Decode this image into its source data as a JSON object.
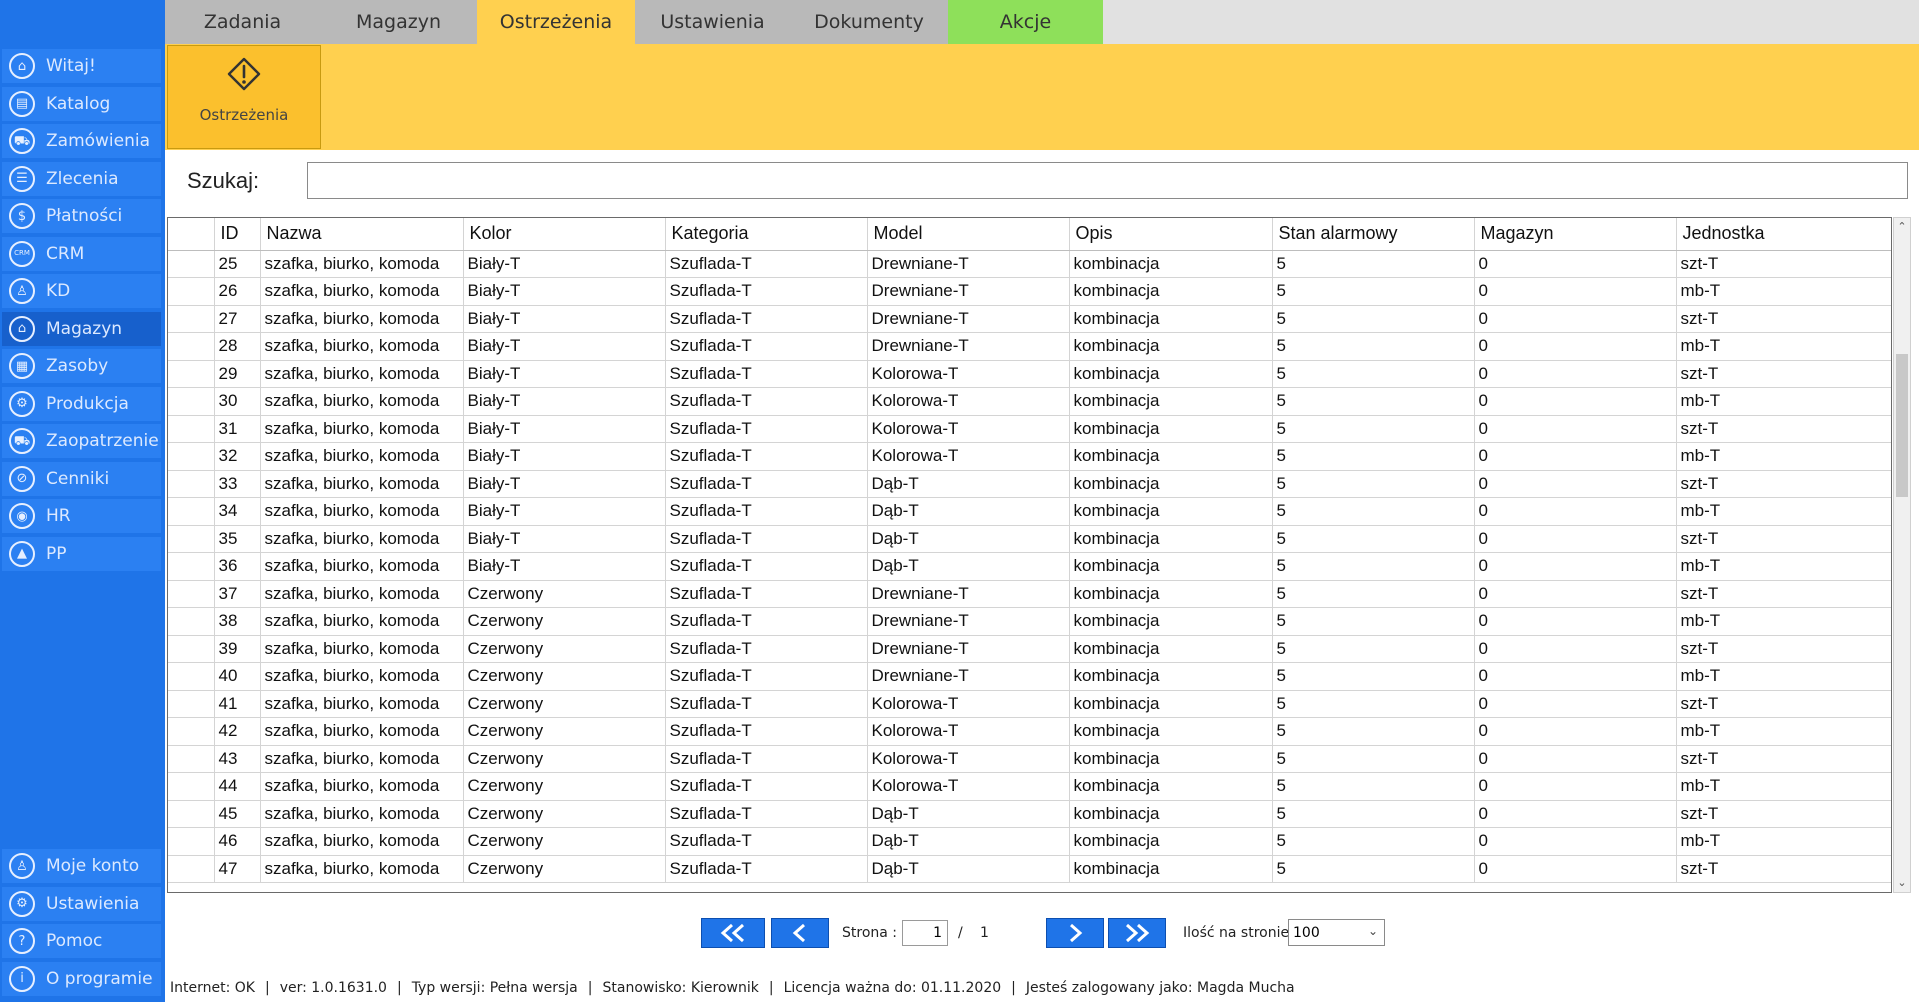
{
  "sidebar": {
    "items": [
      {
        "label": "Witaj!",
        "icon": "home-icon",
        "glyph": "⌂"
      },
      {
        "label": "Katalog",
        "icon": "book-icon",
        "glyph": "▤"
      },
      {
        "label": "Zamówienia",
        "icon": "cart-icon",
        "glyph": "⛟"
      },
      {
        "label": "Zlecenia",
        "icon": "list-icon",
        "glyph": "☰"
      },
      {
        "label": "Płatności",
        "icon": "dollar-icon",
        "glyph": "$"
      },
      {
        "label": "CRM",
        "icon": "crm-icon",
        "glyph": "CRM"
      },
      {
        "label": "KD",
        "icon": "user-icon",
        "glyph": "♙"
      },
      {
        "label": "Magazyn",
        "icon": "warehouse-icon",
        "glyph": "⌂"
      },
      {
        "label": "Zasoby",
        "icon": "box-icon",
        "glyph": "▦"
      },
      {
        "label": "Produkcja",
        "icon": "factory-icon",
        "glyph": "⚙"
      },
      {
        "label": "Zaopatrzenie",
        "icon": "truck-icon",
        "glyph": "⛟"
      },
      {
        "label": "Cenniki",
        "icon": "tag-icon",
        "glyph": "⊘"
      },
      {
        "label": "HR",
        "icon": "fingerprint-icon",
        "glyph": "◉"
      },
      {
        "label": "PP",
        "icon": "chart-icon",
        "glyph": "▲"
      }
    ],
    "bottom_items": [
      {
        "label": "Moje konto",
        "icon": "account-icon",
        "glyph": "♙"
      },
      {
        "label": "Ustawienia",
        "icon": "gear-icon",
        "glyph": "⚙"
      },
      {
        "label": "Pomoc",
        "icon": "help-icon",
        "glyph": "?"
      },
      {
        "label": "O programie",
        "icon": "info-icon",
        "glyph": "i"
      }
    ],
    "active": "Magazyn"
  },
  "tabs": [
    {
      "label": "Zadania",
      "style": "gray"
    },
    {
      "label": "Magazyn",
      "style": "gray"
    },
    {
      "label": "Ostrzeżenia",
      "style": "active"
    },
    {
      "label": "Ustawienia",
      "style": "gray"
    },
    {
      "label": "Dokumenty",
      "style": "gray"
    },
    {
      "label": "Akcje",
      "style": "green"
    }
  ],
  "ribbon": {
    "button_label": "Ostrzeżenia",
    "icon": "warning-icon"
  },
  "search": {
    "label": "Szukaj:",
    "value": "",
    "placeholder": ""
  },
  "table": {
    "columns": [
      "",
      "ID",
      "Nazwa",
      "Kolor",
      "Kategoria",
      "Model",
      "Opis",
      "Stan alarmowy",
      "Magazyn",
      "Jednostka"
    ],
    "rows": [
      [
        "",
        "25",
        "szafka, biurko, komoda",
        "Biały-T",
        "Szuflada-T",
        "Drewniane-T",
        "kombinacja",
        "5",
        "0",
        "szt-T"
      ],
      [
        "",
        "26",
        "szafka, biurko, komoda",
        "Biały-T",
        "Szuflada-T",
        "Drewniane-T",
        "kombinacja",
        "5",
        "0",
        "mb-T"
      ],
      [
        "",
        "27",
        "szafka, biurko, komoda",
        "Biały-T",
        "Szuflada-T",
        "Drewniane-T",
        "kombinacja",
        "5",
        "0",
        "szt-T"
      ],
      [
        "",
        "28",
        "szafka, biurko, komoda",
        "Biały-T",
        "Szuflada-T",
        "Drewniane-T",
        "kombinacja",
        "5",
        "0",
        "mb-T"
      ],
      [
        "",
        "29",
        "szafka, biurko, komoda",
        "Biały-T",
        "Szuflada-T",
        "Kolorowa-T",
        "kombinacja",
        "5",
        "0",
        "szt-T"
      ],
      [
        "",
        "30",
        "szafka, biurko, komoda",
        "Biały-T",
        "Szuflada-T",
        "Kolorowa-T",
        "kombinacja",
        "5",
        "0",
        "mb-T"
      ],
      [
        "",
        "31",
        "szafka, biurko, komoda",
        "Biały-T",
        "Szuflada-T",
        "Kolorowa-T",
        "kombinacja",
        "5",
        "0",
        "szt-T"
      ],
      [
        "",
        "32",
        "szafka, biurko, komoda",
        "Biały-T",
        "Szuflada-T",
        "Kolorowa-T",
        "kombinacja",
        "5",
        "0",
        "mb-T"
      ],
      [
        "",
        "33",
        "szafka, biurko, komoda",
        "Biały-T",
        "Szuflada-T",
        "Dąb-T",
        "kombinacja",
        "5",
        "0",
        "szt-T"
      ],
      [
        "",
        "34",
        "szafka, biurko, komoda",
        "Biały-T",
        "Szuflada-T",
        "Dąb-T",
        "kombinacja",
        "5",
        "0",
        "mb-T"
      ],
      [
        "",
        "35",
        "szafka, biurko, komoda",
        "Biały-T",
        "Szuflada-T",
        "Dąb-T",
        "kombinacja",
        "5",
        "0",
        "szt-T"
      ],
      [
        "",
        "36",
        "szafka, biurko, komoda",
        "Biały-T",
        "Szuflada-T",
        "Dąb-T",
        "kombinacja",
        "5",
        "0",
        "mb-T"
      ],
      [
        "",
        "37",
        "szafka, biurko, komoda",
        "Czerwony",
        "Szuflada-T",
        "Drewniane-T",
        "kombinacja",
        "5",
        "0",
        "szt-T"
      ],
      [
        "",
        "38",
        "szafka, biurko, komoda",
        "Czerwony",
        "Szuflada-T",
        "Drewniane-T",
        "kombinacja",
        "5",
        "0",
        "mb-T"
      ],
      [
        "",
        "39",
        "szafka, biurko, komoda",
        "Czerwony",
        "Szuflada-T",
        "Drewniane-T",
        "kombinacja",
        "5",
        "0",
        "szt-T"
      ],
      [
        "",
        "40",
        "szafka, biurko, komoda",
        "Czerwony",
        "Szuflada-T",
        "Drewniane-T",
        "kombinacja",
        "5",
        "0",
        "mb-T"
      ],
      [
        "",
        "41",
        "szafka, biurko, komoda",
        "Czerwony",
        "Szuflada-T",
        "Kolorowa-T",
        "kombinacja",
        "5",
        "0",
        "szt-T"
      ],
      [
        "",
        "42",
        "szafka, biurko, komoda",
        "Czerwony",
        "Szuflada-T",
        "Kolorowa-T",
        "kombinacja",
        "5",
        "0",
        "mb-T"
      ],
      [
        "",
        "43",
        "szafka, biurko, komoda",
        "Czerwony",
        "Szuflada-T",
        "Kolorowa-T",
        "kombinacja",
        "5",
        "0",
        "szt-T"
      ],
      [
        "",
        "44",
        "szafka, biurko, komoda",
        "Czerwony",
        "Szuflada-T",
        "Kolorowa-T",
        "kombinacja",
        "5",
        "0",
        "mb-T"
      ],
      [
        "",
        "45",
        "szafka, biurko, komoda",
        "Czerwony",
        "Szuflada-T",
        "Dąb-T",
        "kombinacja",
        "5",
        "0",
        "szt-T"
      ],
      [
        "",
        "46",
        "szafka, biurko, komoda",
        "Czerwony",
        "Szuflada-T",
        "Dąb-T",
        "kombinacja",
        "5",
        "0",
        "mb-T"
      ],
      [
        "",
        "47",
        "szafka, biurko, komoda",
        "Czerwony",
        "Szuflada-T",
        "Dąb-T",
        "kombinacja",
        "5",
        "0",
        "szt-T"
      ]
    ]
  },
  "pagination": {
    "first_icon": "double-chevron-left-icon",
    "prev_icon": "chevron-left-icon",
    "next_icon": "chevron-right-icon",
    "last_icon": "double-chevron-right-icon",
    "page_label": "Strona :",
    "current_page": "1",
    "separator": "/",
    "total_pages": "1",
    "per_page_label": "Ilość na stronie:",
    "per_page_value": "100"
  },
  "status": {
    "internet": "Internet: OK",
    "version": "ver: 1.0.1631.0",
    "edition": "Typ wersji: Pełna wersja",
    "workstation": "Stanowisko: Kierownik",
    "license": "Licencja ważna do: 01.11.2020",
    "user": "Jesteś zalogowany jako: Magda Mucha"
  },
  "colors": {
    "sidebar": "#1f74e8",
    "sidebar_item": "#2b80f2",
    "accent_yellow": "#ffd04f",
    "tab_green": "#8ee05a",
    "tab_gray": "#b9b9b9"
  }
}
